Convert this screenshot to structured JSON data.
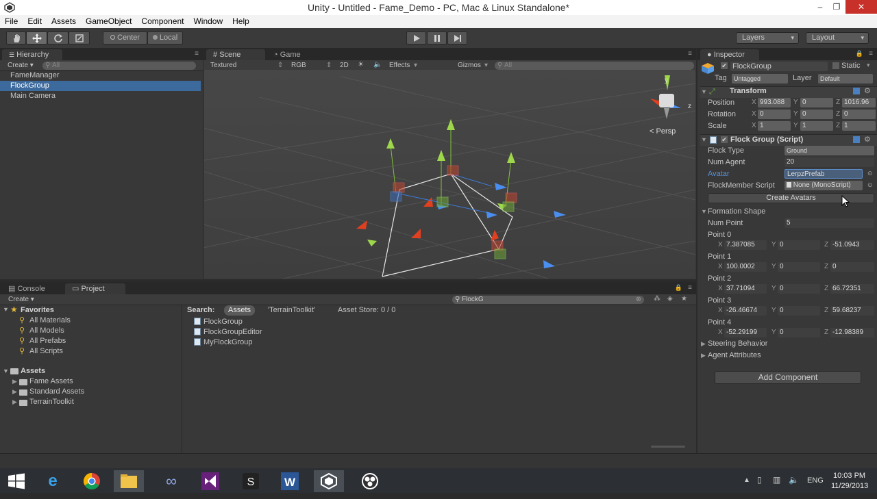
{
  "window": {
    "title": "Unity - Untitled - Fame_Demo - PC, Mac & Linux Standalone*",
    "minimize": "–",
    "restore": "❐",
    "close": "✕"
  },
  "menu": [
    "File",
    "Edit",
    "Assets",
    "GameObject",
    "Component",
    "Window",
    "Help"
  ],
  "toolbar": {
    "pivot_center": "Center",
    "pivot_local": "Local",
    "layers": "Layers",
    "layout": "Layout"
  },
  "hierarchy": {
    "tab": "Hierarchy",
    "create": "Create ▾",
    "search_placeholder": "All",
    "items": [
      "FameManager",
      "FlockGroup",
      "Main Camera"
    ]
  },
  "scene": {
    "tab_scene": "Scene",
    "tab_game": "Game",
    "shading": "Textured",
    "render": "RGB",
    "mode2d": "2D",
    "effects": "Effects",
    "gizmos": "Gizmos",
    "search_placeholder": "All",
    "persp": "Persp",
    "axis_y": "y",
    "axis_z": "z"
  },
  "inspector": {
    "tab": "Inspector",
    "object_name": "FlockGroup",
    "static_label": "Static",
    "tag_label": "Tag",
    "tag_value": "Untagged",
    "layer_label": "Layer",
    "layer_value": "Default",
    "transform": {
      "title": "Transform",
      "position_label": "Position",
      "rotation_label": "Rotation",
      "scale_label": "Scale",
      "position": {
        "x": "993.088",
        "y": "0",
        "z": "1016.96"
      },
      "rotation": {
        "x": "0",
        "y": "0",
        "z": "0"
      },
      "scale": {
        "x": "1",
        "y": "1",
        "z": "1"
      }
    },
    "flock_script": {
      "title": "Flock Group (Script)",
      "flock_type_label": "Flock Type",
      "flock_type_value": "Ground",
      "num_agent_label": "Num Agent",
      "num_agent_value": "20",
      "avatar_label": "Avatar",
      "avatar_value": "LerpzPrefab",
      "member_script_label": "FlockMember Script",
      "member_script_value": "None (MonoScript)",
      "create_button": "Create Avatars"
    },
    "formation": {
      "title": "Formation Shape",
      "num_point_label": "Num Point",
      "num_point_value": "5",
      "points": [
        {
          "label": "Point 0",
          "x": "7.387085",
          "y": "0",
          "z": "-51.0943"
        },
        {
          "label": "Point 1",
          "x": "100.0002",
          "y": "0",
          "z": "0"
        },
        {
          "label": "Point 2",
          "x": "37.71094",
          "y": "0",
          "z": "66.72351"
        },
        {
          "label": "Point 3",
          "x": "-26.46674",
          "y": "0",
          "z": "59.68237"
        },
        {
          "label": "Point 4",
          "x": "-52.29199",
          "y": "0",
          "z": "-12.98389"
        }
      ]
    },
    "steering": "Steering Behavior",
    "agent_attr": "Agent Attributes",
    "add_component": "Add Component",
    "axis_labels": {
      "x": "X",
      "y": "Y",
      "z": "Z"
    }
  },
  "bottom": {
    "tab_console": "Console",
    "tab_project": "Project",
    "create": "Create ▾",
    "search_value": "FlockG",
    "favorites_title": "Favorites",
    "favorites": [
      "All Materials",
      "All Models",
      "All Prefabs",
      "All Scripts"
    ],
    "assets_title": "Assets",
    "folders": [
      "Fame Assets",
      "Standard Assets",
      "TerrainToolkit"
    ],
    "search_label": "Search:",
    "search_scope_assets": "Assets",
    "search_scope_terrain": "'TerrainToolkit'",
    "asset_store": "Asset Store: 0 / 0",
    "results": [
      "FlockGroup",
      "FlockGroupEditor",
      "MyFlockGroup"
    ]
  },
  "taskbar": {
    "time": "10:03 PM",
    "date": "11/29/2013",
    "lang": "ENG"
  }
}
